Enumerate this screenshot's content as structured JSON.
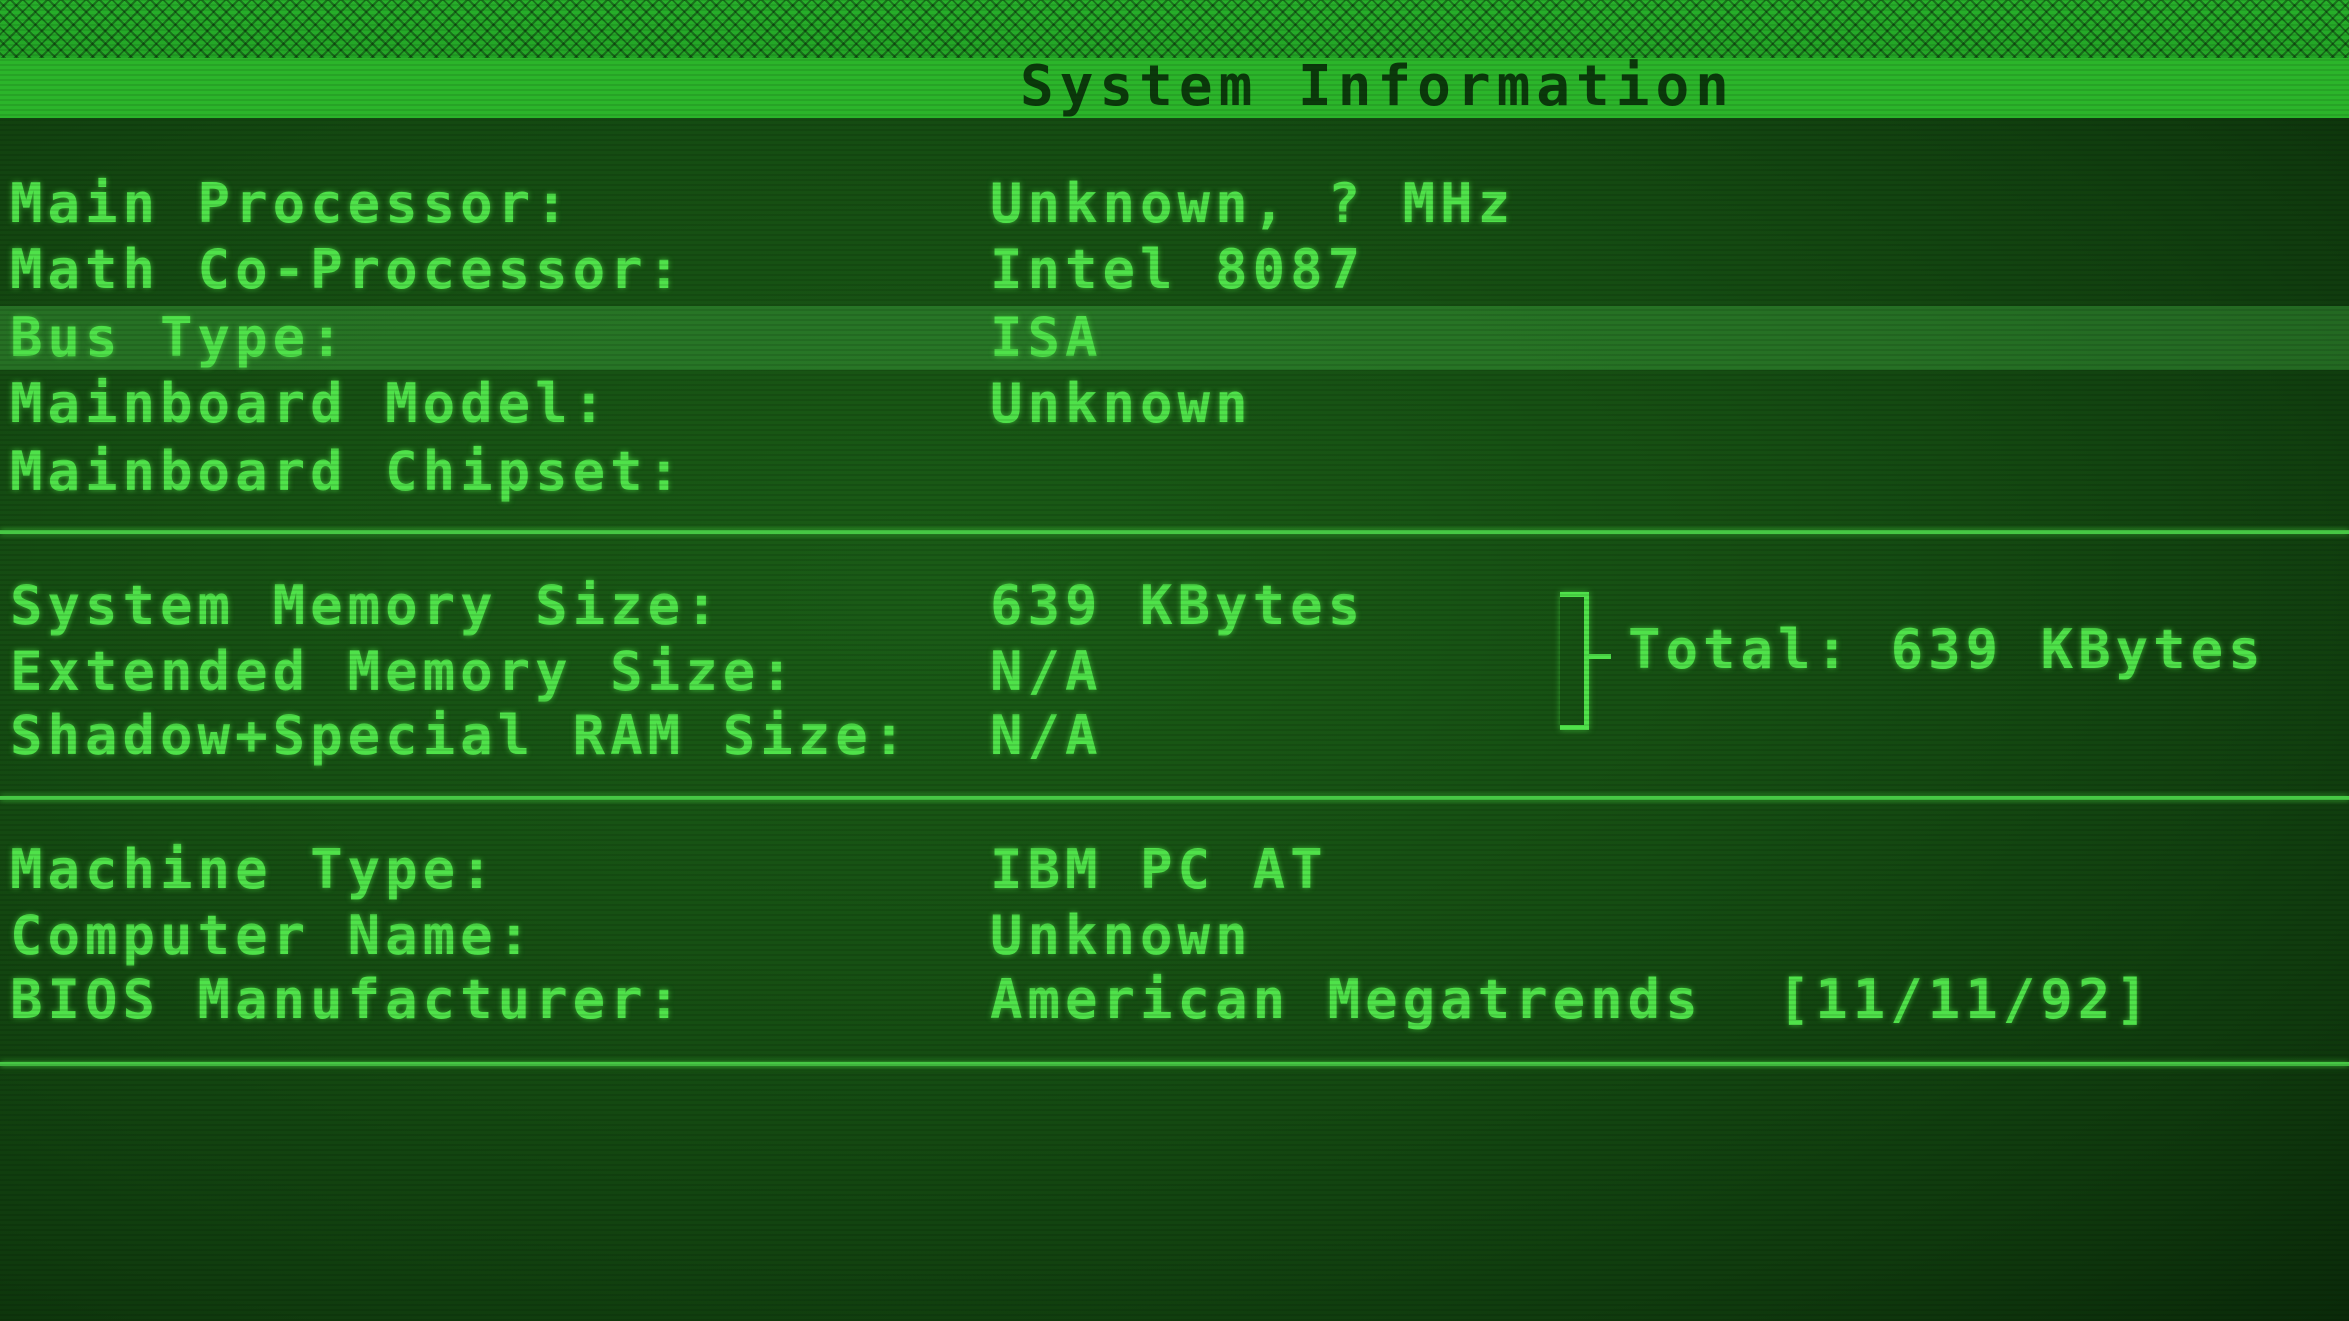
{
  "title": "System Information",
  "hardware": {
    "rows": [
      {
        "label": "Main Processor:",
        "value": "Unknown, ? MHz"
      },
      {
        "label": "Math Co-Processor:",
        "value": "Intel 8087"
      },
      {
        "label": "Bus Type:",
        "value": "ISA"
      },
      {
        "label": "Mainboard Model:",
        "value": "Unknown"
      },
      {
        "label": "Mainboard Chipset:",
        "value": ""
      }
    ]
  },
  "memory": {
    "rows": [
      {
        "label": "System Memory Size:",
        "value": "639 KBytes"
      },
      {
        "label": "Extended Memory Size:",
        "value": "N/A"
      },
      {
        "label": "Shadow+Special RAM Size:",
        "value": "N/A"
      }
    ],
    "total": "Total: 639 KBytes"
  },
  "machine": {
    "rows": [
      {
        "label": "Machine Type:",
        "value": "IBM PC AT"
      },
      {
        "label": "Computer Name:",
        "value": "Unknown"
      },
      {
        "label": "BIOS Manufacturer:",
        "value": "American Megatrends  [11/11/92]"
      }
    ]
  },
  "colors": {
    "text": "#4fe24a",
    "background": "#154d12",
    "title_bar": "#2bb52a",
    "highlight": "#3ca03c"
  }
}
